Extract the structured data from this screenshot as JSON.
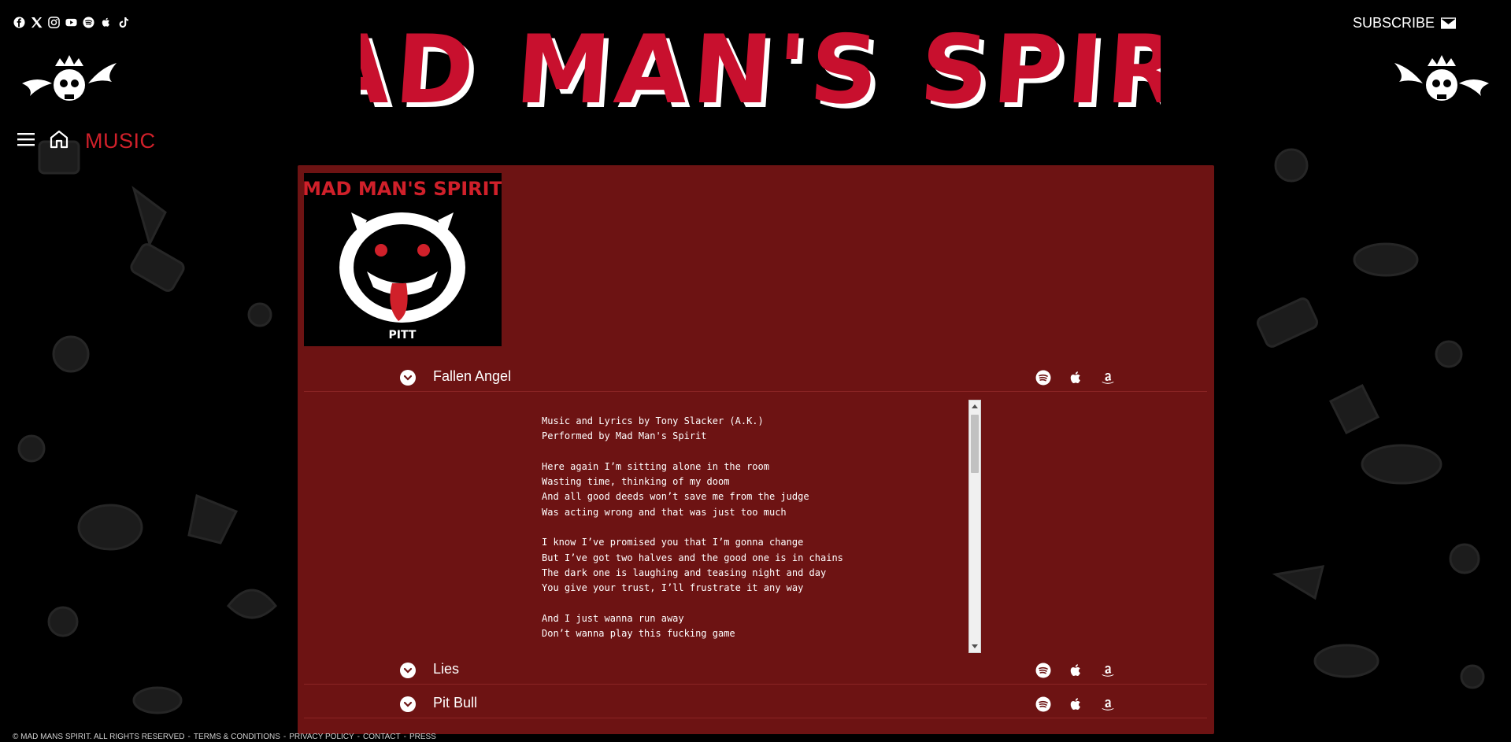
{
  "social": [
    {
      "name": "facebook-icon"
    },
    {
      "name": "x-icon"
    },
    {
      "name": "instagram-icon"
    },
    {
      "name": "youtube-icon"
    },
    {
      "name": "spotify-icon"
    },
    {
      "name": "apple-icon"
    },
    {
      "name": "tiktok-icon"
    }
  ],
  "header": {
    "subscribe_label": "SUBSCRIBE",
    "brand_title": "MAD MAN'S SPIRIT"
  },
  "nav": {
    "section": "MUSIC"
  },
  "album": {
    "cover_title": "MAD MAN'S SPIRIT",
    "cover_subtitle": "PITT"
  },
  "tracks": [
    {
      "title": "Fallen Angel",
      "expanded": true
    },
    {
      "title": "Lies",
      "expanded": false
    },
    {
      "title": "Pit Bull",
      "expanded": false
    }
  ],
  "lyrics": {
    "text": "Music and Lyrics by Tony Slacker (A.K.)\nPerformed by Mad Man's Spirit\n\nHere again I’m sitting alone in the room\nWasting time, thinking of my doom\nAnd all good deeds won’t save me from the judge\nWas acting wrong and that was just too much\n\nI know I’ve promised you that I’m gonna change\nBut I’ve got two halves and the good one is in chains\nThe dark one is laughing and teasing night and day\nYou give your trust, I’ll frustrate it any way\n\nAnd I just wanna run away\nDon’t wanna play this fucking game"
  },
  "footer": {
    "copyright": "© MAD MANS SPIRIT. ALL RIGHTS RESERVED",
    "links": [
      "TERMS & CONDITIONS",
      "PRIVACY POLICY",
      "CONTACT",
      "PRESS"
    ]
  },
  "colors": {
    "background": "#000000",
    "panel": "#6d1313",
    "accent_red": "#d0202a",
    "title_red": "#c8102e"
  }
}
